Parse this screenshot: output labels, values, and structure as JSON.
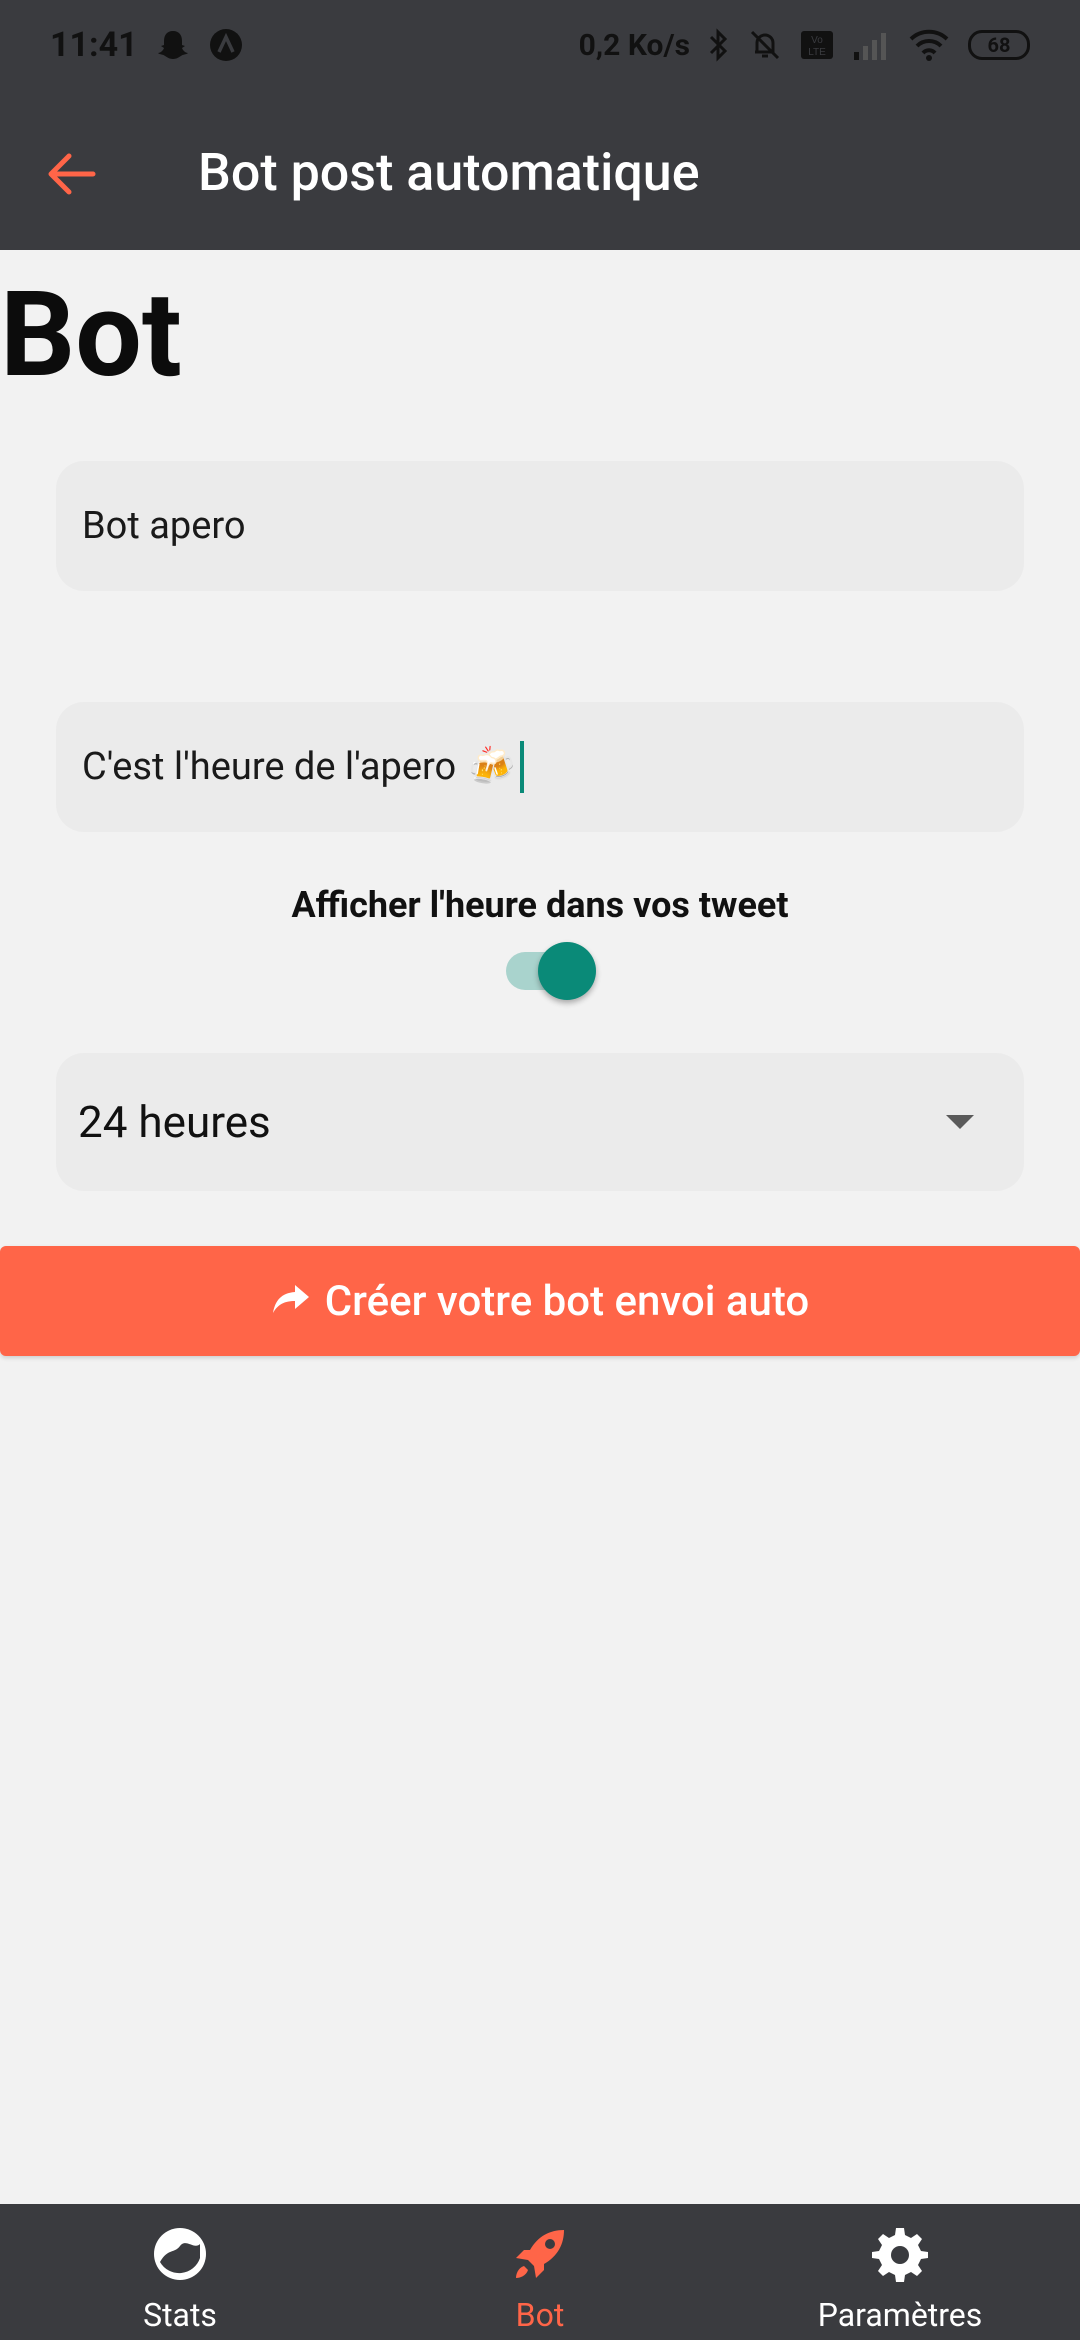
{
  "status_bar": {
    "time": "11:41",
    "net_speed": "0,2 Ko/s",
    "battery": "68",
    "icons": [
      "snapchat-icon",
      "app-icon",
      "bluetooth-icon",
      "notifications-off-icon",
      "volte-icon",
      "signal-icon",
      "wifi-icon",
      "battery-icon"
    ]
  },
  "app_bar": {
    "title": "Bot post automatique",
    "back_icon": "arrow-left-icon"
  },
  "page": {
    "title": "Bot"
  },
  "form": {
    "name_value": "Bot apero",
    "message_value": "C'est l'heure de l'apero",
    "message_emoji": "🍻",
    "toggle_label": "Afficher l'heure dans vos tweet",
    "toggle_on": true,
    "interval_selected": "24 heures",
    "submit_label": "Créer votre bot envoi auto"
  },
  "bottom_nav": {
    "items": [
      {
        "label": "Stats",
        "icon": "chart-icon",
        "active": false
      },
      {
        "label": "Bot",
        "icon": "rocket-icon",
        "active": true
      },
      {
        "label": "Paramètres",
        "icon": "gear-icon",
        "active": false
      }
    ]
  },
  "colors": {
    "accent": "#ff6548",
    "dark_bg": "#3a3b3f",
    "toggle": "#0a8a78"
  }
}
